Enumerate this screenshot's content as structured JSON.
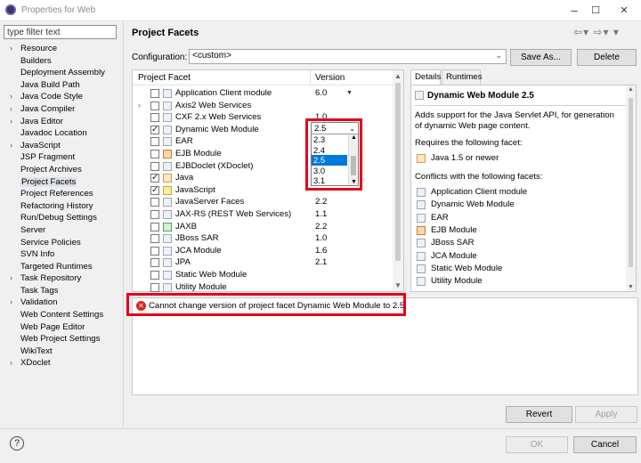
{
  "window": {
    "title": "Properties for Web"
  },
  "filter": {
    "placeholder": "type filter text",
    "value": "type filter text"
  },
  "nav": {
    "items": [
      {
        "label": "Resource",
        "expandable": true
      },
      {
        "label": "Builders",
        "expandable": false
      },
      {
        "label": "Deployment Assembly",
        "expandable": false
      },
      {
        "label": "Java Build Path",
        "expandable": false
      },
      {
        "label": "Java Code Style",
        "expandable": true
      },
      {
        "label": "Java Compiler",
        "expandable": true
      },
      {
        "label": "Java Editor",
        "expandable": true
      },
      {
        "label": "Javadoc Location",
        "expandable": false
      },
      {
        "label": "JavaScript",
        "expandable": true
      },
      {
        "label": "JSP Fragment",
        "expandable": false
      },
      {
        "label": "Project Archives",
        "expandable": false
      },
      {
        "label": "Project Facets",
        "expandable": false,
        "selected": true
      },
      {
        "label": "Project References",
        "expandable": false
      },
      {
        "label": "Refactoring History",
        "expandable": false
      },
      {
        "label": "Run/Debug Settings",
        "expandable": false
      },
      {
        "label": "Server",
        "expandable": false
      },
      {
        "label": "Service Policies",
        "expandable": false
      },
      {
        "label": "SVN Info",
        "expandable": false
      },
      {
        "label": "Targeted Runtimes",
        "expandable": false
      },
      {
        "label": "Task Repository",
        "expandable": true
      },
      {
        "label": "Task Tags",
        "expandable": false
      },
      {
        "label": "Validation",
        "expandable": true
      },
      {
        "label": "Web Content Settings",
        "expandable": false
      },
      {
        "label": "Web Page Editor",
        "expandable": false
      },
      {
        "label": "Web Project Settings",
        "expandable": false
      },
      {
        "label": "WikiText",
        "expandable": false
      },
      {
        "label": "XDoclet",
        "expandable": true
      }
    ]
  },
  "page": {
    "title": "Project Facets",
    "configuration_label": "Configuration:",
    "configuration_value": "<custom>",
    "save_as_label": "Save As...",
    "delete_label": "Delete"
  },
  "facets": {
    "col_facet": "Project Facet",
    "col_version": "Version",
    "rows": [
      {
        "name": "Application Client module",
        "version": "6.0",
        "checked": false,
        "expand": false,
        "icon": "module",
        "dropdown": true
      },
      {
        "name": "Axis2 Web Services",
        "version": "",
        "checked": false,
        "expand": true,
        "icon": "module",
        "dropdown": false
      },
      {
        "name": "CXF 2.x Web Services",
        "version": "1.0",
        "checked": false,
        "expand": false,
        "icon": "module",
        "dropdown": false
      },
      {
        "name": "Dynamic Web Module",
        "version": "2.5",
        "checked": true,
        "expand": false,
        "icon": "module",
        "dropdown": false
      },
      {
        "name": "EAR",
        "version": "",
        "checked": false,
        "expand": false,
        "icon": "module",
        "dropdown": false
      },
      {
        "name": "EJB Module",
        "version": "",
        "checked": false,
        "expand": false,
        "icon": "ejb",
        "dropdown": false
      },
      {
        "name": "EJBDoclet (XDoclet)",
        "version": "",
        "checked": false,
        "expand": false,
        "icon": "module",
        "dropdown": false
      },
      {
        "name": "Java",
        "version": "",
        "checked": true,
        "expand": false,
        "icon": "java",
        "dropdown": false
      },
      {
        "name": "JavaScript",
        "version": "",
        "checked": true,
        "expand": false,
        "icon": "js",
        "dropdown": false
      },
      {
        "name": "JavaServer Faces",
        "version": "2.2",
        "checked": false,
        "expand": false,
        "icon": "module",
        "dropdown": false
      },
      {
        "name": "JAX-RS (REST Web Services)",
        "version": "1.1",
        "checked": false,
        "expand": false,
        "icon": "module",
        "dropdown": false
      },
      {
        "name": "JAXB",
        "version": "2.2",
        "checked": false,
        "expand": false,
        "icon": "jaxb",
        "dropdown": false
      },
      {
        "name": "JBoss SAR",
        "version": "1.0",
        "checked": false,
        "expand": false,
        "icon": "module",
        "dropdown": false
      },
      {
        "name": "JCA Module",
        "version": "1.6",
        "checked": false,
        "expand": false,
        "icon": "module",
        "dropdown": false
      },
      {
        "name": "JPA",
        "version": "2.1",
        "checked": false,
        "expand": false,
        "icon": "module",
        "dropdown": false
      },
      {
        "name": "Static Web Module",
        "version": "",
        "checked": false,
        "expand": false,
        "icon": "module",
        "dropdown": false
      },
      {
        "name": "Utility Module",
        "version": "",
        "checked": false,
        "expand": false,
        "icon": "module",
        "dropdown": false
      }
    ]
  },
  "version_dropdown": {
    "current": "2.5",
    "options": [
      "2.3",
      "2.4",
      "2.5",
      "3.0",
      "3.1"
    ],
    "highlighted": "2.5"
  },
  "details": {
    "tab_details": "Details",
    "tab_runtimes": "Runtimes",
    "title": "Dynamic Web Module 2.5",
    "description_line1": "Adds support for the Java Servlet API, for generation",
    "description_line2": "of dynamic Web page content.",
    "requires_label": "Requires the following facet:",
    "requires": [
      "Java 1.5 or newer"
    ],
    "conflicts_label": "Conflicts with the following facets:",
    "conflicts": [
      "Application Client module",
      "Dynamic Web Module",
      "EAR",
      "EJB Module",
      "JBoss SAR",
      "JCA Module",
      "Static Web Module",
      "Utility Module"
    ]
  },
  "error": {
    "message": "Cannot change version of project facet Dynamic Web Module to 2.5."
  },
  "buttons": {
    "revert": "Revert",
    "apply": "Apply",
    "ok": "OK",
    "cancel": "Cancel",
    "help": "?"
  },
  "icons": {
    "app": "eclipse-icon",
    "minimize": "–",
    "maximize": "☐",
    "close": "✕",
    "back": "⇦",
    "forward": "⇨",
    "menu": "▾"
  },
  "colors": {
    "highlight_box": "#e3001b",
    "selection": "#0078d7",
    "error": "#d9241c"
  }
}
